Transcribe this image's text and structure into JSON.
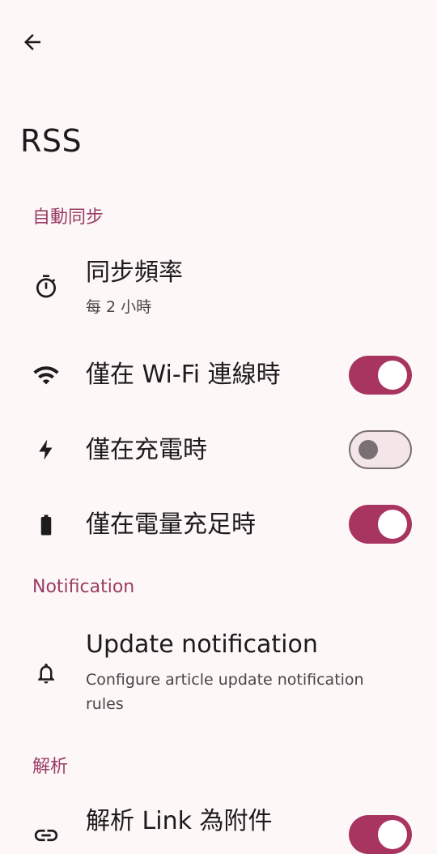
{
  "header": {
    "title": "RSS"
  },
  "sections": {
    "auto_sync": {
      "label": "自動同步"
    },
    "notification": {
      "label": "Notification"
    },
    "parse": {
      "label": "解析"
    }
  },
  "sync_frequency": {
    "title": "同步頻率",
    "value": "每 2 小時",
    "icon": "timer-icon"
  },
  "wifi_only": {
    "title": "僅在 Wi-Fi 連線時",
    "enabled": true,
    "icon": "wifi-icon"
  },
  "charging_only": {
    "title": "僅在充電時",
    "enabled": false,
    "icon": "bolt-icon"
  },
  "battery_only": {
    "title": "僅在電量充足時",
    "enabled": true,
    "icon": "battery-icon"
  },
  "update_notification": {
    "title": "Update notification",
    "subtitle": "Configure article update notification rules",
    "icon": "bell-icon"
  },
  "parse_links": {
    "title": "解析 Link 為附件",
    "enabled": true,
    "icon": "link-icon"
  },
  "colors": {
    "accent": "#9a3d64",
    "switch_on": "#a8355f",
    "background": "#fdf7f7"
  }
}
